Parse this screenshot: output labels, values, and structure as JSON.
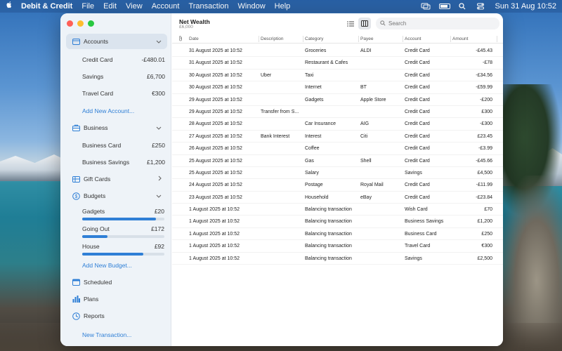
{
  "menubar": {
    "app_name": "Debit & Credit",
    "items": [
      "File",
      "Edit",
      "View",
      "Account",
      "Transaction",
      "Window",
      "Help"
    ],
    "clock": "Sun 31 Aug  10:52"
  },
  "sidebar": {
    "accounts_label": "Accounts",
    "accounts": [
      {
        "name": "Credit Card",
        "value": "-£480.01"
      },
      {
        "name": "Savings",
        "value": "£6,700"
      },
      {
        "name": "Travel Card",
        "value": "€300"
      }
    ],
    "add_account": "Add New Account...",
    "business_label": "Business",
    "business": [
      {
        "name": "Business Card",
        "value": "£250"
      },
      {
        "name": "Business Savings",
        "value": "£1,200"
      }
    ],
    "gift_cards_label": "Gift Cards",
    "budgets_label": "Budgets",
    "budgets": [
      {
        "name": "Gadgets",
        "value": "£20",
        "progress": 0.9
      },
      {
        "name": "Going Out",
        "value": "£172",
        "progress": 0.31
      },
      {
        "name": "House",
        "value": "£92",
        "progress": 0.74
      }
    ],
    "add_budget": "Add New Budget...",
    "scheduled_label": "Scheduled",
    "plans_label": "Plans",
    "reports_label": "Reports",
    "new_transaction": "New Transaction..."
  },
  "header": {
    "title": "Net Wealth",
    "value": "£6,000",
    "search_placeholder": "Search"
  },
  "table": {
    "columns": [
      "Date",
      "Description",
      "Category",
      "Payee",
      "Account",
      "Amount"
    ],
    "rows": [
      {
        "date": "31 August 2025 at 10:52",
        "desc": "",
        "cat": "Groceries",
        "payee": "ALDI",
        "acct": "Credit Card",
        "amt": "-£45.43"
      },
      {
        "date": "31 August 2025 at 10:52",
        "desc": "",
        "cat": "Restaurant & Cafes",
        "payee": "",
        "acct": "Credit Card",
        "amt": "-£78"
      },
      {
        "date": "30 August 2025 at 10:52",
        "desc": "Uber",
        "cat": "Taxi",
        "payee": "",
        "acct": "Credit Card",
        "amt": "-£34.56"
      },
      {
        "date": "30 August 2025 at 10:52",
        "desc": "",
        "cat": "Internet",
        "payee": "BT",
        "acct": "Credit Card",
        "amt": "-£59.99"
      },
      {
        "date": "29 August 2025 at 10:52",
        "desc": "",
        "cat": "Gadgets",
        "payee": "Apple Store",
        "acct": "Credit Card",
        "amt": "-£200"
      },
      {
        "date": "29 August 2025 at 10:52",
        "desc": "Transfer from S...",
        "cat": "",
        "payee": "",
        "acct": "Credit Card",
        "amt": "£300"
      },
      {
        "date": "28 August 2025 at 10:52",
        "desc": "",
        "cat": "Car Insurance",
        "payee": "AIG",
        "acct": "Credit Card",
        "amt": "-£300"
      },
      {
        "date": "27 August 2025 at 10:52",
        "desc": "Bank Interest",
        "cat": "Interest",
        "payee": "Citi",
        "acct": "Credit Card",
        "amt": "£23.45"
      },
      {
        "date": "26 August 2025 at 10:52",
        "desc": "",
        "cat": "Coffee",
        "payee": "",
        "acct": "Credit Card",
        "amt": "-£3.99"
      },
      {
        "date": "25 August 2025 at 10:52",
        "desc": "",
        "cat": "Gas",
        "payee": "Shell",
        "acct": "Credit Card",
        "amt": "-£45.66"
      },
      {
        "date": "25 August 2025 at 10:52",
        "desc": "",
        "cat": "Salary",
        "payee": "",
        "acct": "Savings",
        "amt": "£4,500"
      },
      {
        "date": "24 August 2025 at 10:52",
        "desc": "",
        "cat": "Postage",
        "payee": "Royal Mail",
        "acct": "Credit Card",
        "amt": "-£11.99"
      },
      {
        "date": "23 August 2025 at 10:52",
        "desc": "",
        "cat": "Household",
        "payee": "eBay",
        "acct": "Credit Card",
        "amt": "-£23.84"
      },
      {
        "date": "1 August 2025 at 10:52",
        "desc": "",
        "cat": "Balancing transaction",
        "payee": "",
        "acct": "Wish Card",
        "amt": "£70"
      },
      {
        "date": "1 August 2025 at 10:52",
        "desc": "",
        "cat": "Balancing transaction",
        "payee": "",
        "acct": "Business Savings",
        "amt": "£1,200"
      },
      {
        "date": "1 August 2025 at 10:52",
        "desc": "",
        "cat": "Balancing transaction",
        "payee": "",
        "acct": "Business Card",
        "amt": "£250"
      },
      {
        "date": "1 August 2025 at 10:52",
        "desc": "",
        "cat": "Balancing transaction",
        "payee": "",
        "acct": "Travel Card",
        "amt": "€300"
      },
      {
        "date": "1 August 2025 at 10:52",
        "desc": "",
        "cat": "Balancing transaction",
        "payee": "",
        "acct": "Savings",
        "amt": "£2,500"
      }
    ]
  },
  "colors": {
    "accent": "#2f7fd6",
    "sidebar_bg": "#eef3f8"
  }
}
